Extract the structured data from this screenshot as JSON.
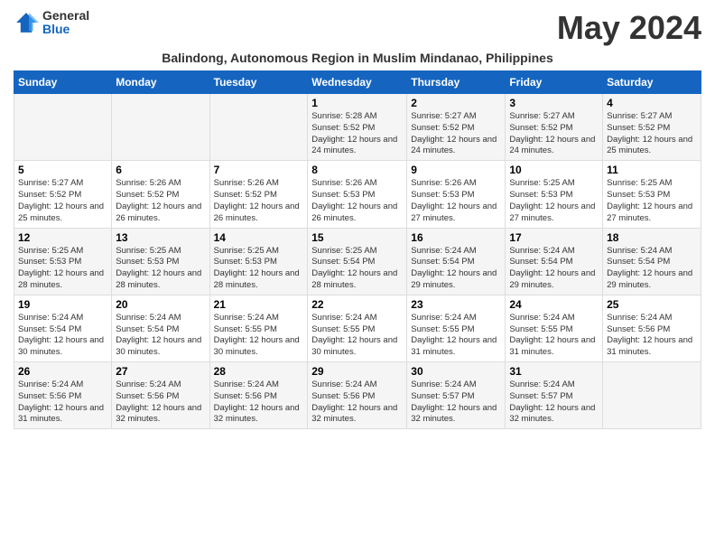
{
  "logo": {
    "general": "General",
    "blue": "Blue"
  },
  "title": "May 2024",
  "subtitle": "Balindong, Autonomous Region in Muslim Mindanao, Philippines",
  "days_header": [
    "Sunday",
    "Monday",
    "Tuesday",
    "Wednesday",
    "Thursday",
    "Friday",
    "Saturday"
  ],
  "weeks": [
    [
      {
        "num": "",
        "info": ""
      },
      {
        "num": "",
        "info": ""
      },
      {
        "num": "",
        "info": ""
      },
      {
        "num": "1",
        "info": "Sunrise: 5:28 AM\nSunset: 5:52 PM\nDaylight: 12 hours\nand 24 minutes."
      },
      {
        "num": "2",
        "info": "Sunrise: 5:27 AM\nSunset: 5:52 PM\nDaylight: 12 hours\nand 24 minutes."
      },
      {
        "num": "3",
        "info": "Sunrise: 5:27 AM\nSunset: 5:52 PM\nDaylight: 12 hours\nand 24 minutes."
      },
      {
        "num": "4",
        "info": "Sunrise: 5:27 AM\nSunset: 5:52 PM\nDaylight: 12 hours\nand 25 minutes."
      }
    ],
    [
      {
        "num": "5",
        "info": "Sunrise: 5:27 AM\nSunset: 5:52 PM\nDaylight: 12 hours\nand 25 minutes."
      },
      {
        "num": "6",
        "info": "Sunrise: 5:26 AM\nSunset: 5:52 PM\nDaylight: 12 hours\nand 26 minutes."
      },
      {
        "num": "7",
        "info": "Sunrise: 5:26 AM\nSunset: 5:52 PM\nDaylight: 12 hours\nand 26 minutes."
      },
      {
        "num": "8",
        "info": "Sunrise: 5:26 AM\nSunset: 5:53 PM\nDaylight: 12 hours\nand 26 minutes."
      },
      {
        "num": "9",
        "info": "Sunrise: 5:26 AM\nSunset: 5:53 PM\nDaylight: 12 hours\nand 27 minutes."
      },
      {
        "num": "10",
        "info": "Sunrise: 5:25 AM\nSunset: 5:53 PM\nDaylight: 12 hours\nand 27 minutes."
      },
      {
        "num": "11",
        "info": "Sunrise: 5:25 AM\nSunset: 5:53 PM\nDaylight: 12 hours\nand 27 minutes."
      }
    ],
    [
      {
        "num": "12",
        "info": "Sunrise: 5:25 AM\nSunset: 5:53 PM\nDaylight: 12 hours\nand 28 minutes."
      },
      {
        "num": "13",
        "info": "Sunrise: 5:25 AM\nSunset: 5:53 PM\nDaylight: 12 hours\nand 28 minutes."
      },
      {
        "num": "14",
        "info": "Sunrise: 5:25 AM\nSunset: 5:53 PM\nDaylight: 12 hours\nand 28 minutes."
      },
      {
        "num": "15",
        "info": "Sunrise: 5:25 AM\nSunset: 5:54 PM\nDaylight: 12 hours\nand 28 minutes."
      },
      {
        "num": "16",
        "info": "Sunrise: 5:24 AM\nSunset: 5:54 PM\nDaylight: 12 hours\nand 29 minutes."
      },
      {
        "num": "17",
        "info": "Sunrise: 5:24 AM\nSunset: 5:54 PM\nDaylight: 12 hours\nand 29 minutes."
      },
      {
        "num": "18",
        "info": "Sunrise: 5:24 AM\nSunset: 5:54 PM\nDaylight: 12 hours\nand 29 minutes."
      }
    ],
    [
      {
        "num": "19",
        "info": "Sunrise: 5:24 AM\nSunset: 5:54 PM\nDaylight: 12 hours\nand 30 minutes."
      },
      {
        "num": "20",
        "info": "Sunrise: 5:24 AM\nSunset: 5:54 PM\nDaylight: 12 hours\nand 30 minutes."
      },
      {
        "num": "21",
        "info": "Sunrise: 5:24 AM\nSunset: 5:55 PM\nDaylight: 12 hours\nand 30 minutes."
      },
      {
        "num": "22",
        "info": "Sunrise: 5:24 AM\nSunset: 5:55 PM\nDaylight: 12 hours\nand 30 minutes."
      },
      {
        "num": "23",
        "info": "Sunrise: 5:24 AM\nSunset: 5:55 PM\nDaylight: 12 hours\nand 31 minutes."
      },
      {
        "num": "24",
        "info": "Sunrise: 5:24 AM\nSunset: 5:55 PM\nDaylight: 12 hours\nand 31 minutes."
      },
      {
        "num": "25",
        "info": "Sunrise: 5:24 AM\nSunset: 5:56 PM\nDaylight: 12 hours\nand 31 minutes."
      }
    ],
    [
      {
        "num": "26",
        "info": "Sunrise: 5:24 AM\nSunset: 5:56 PM\nDaylight: 12 hours\nand 31 minutes."
      },
      {
        "num": "27",
        "info": "Sunrise: 5:24 AM\nSunset: 5:56 PM\nDaylight: 12 hours\nand 32 minutes."
      },
      {
        "num": "28",
        "info": "Sunrise: 5:24 AM\nSunset: 5:56 PM\nDaylight: 12 hours\nand 32 minutes."
      },
      {
        "num": "29",
        "info": "Sunrise: 5:24 AM\nSunset: 5:56 PM\nDaylight: 12 hours\nand 32 minutes."
      },
      {
        "num": "30",
        "info": "Sunrise: 5:24 AM\nSunset: 5:57 PM\nDaylight: 12 hours\nand 32 minutes."
      },
      {
        "num": "31",
        "info": "Sunrise: 5:24 AM\nSunset: 5:57 PM\nDaylight: 12 hours\nand 32 minutes."
      },
      {
        "num": "",
        "info": ""
      }
    ]
  ]
}
